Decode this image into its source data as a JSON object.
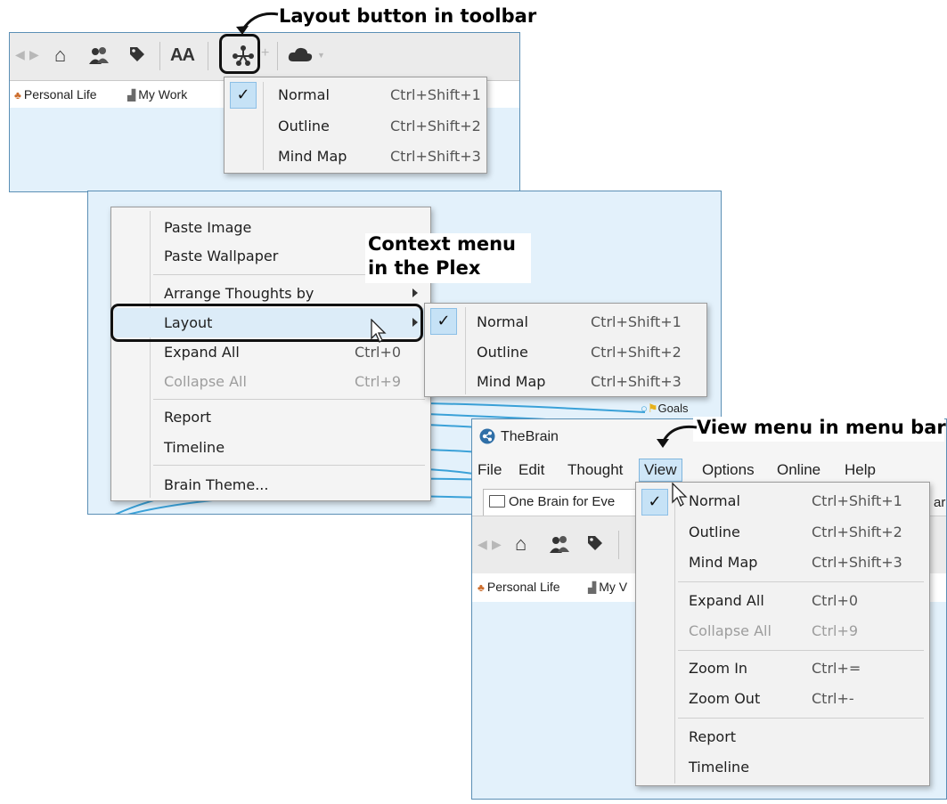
{
  "callouts": {
    "toolbar_layout": "Layout button in toolbar",
    "context_line1": "Context menu",
    "context_line2": "in the Plex",
    "view_menu": "View menu in menu bar"
  },
  "colors": {
    "plex_background": "#e3f1fb",
    "highlight": "#dcecf8",
    "check_background": "#c6e2f6",
    "link_lines": "#3aa1d8"
  },
  "toolbar_shot": {
    "icons": [
      "back-arrow-icon",
      "forward-arrow-icon",
      "home-icon",
      "people-icon",
      "tag-icon",
      "font-size-icon",
      "layout-icon",
      "cloud-icon"
    ],
    "font_size_label": "AA",
    "bookmarks": [
      "Personal Life",
      "My Work"
    ],
    "layout_menu": [
      {
        "label": "Normal",
        "shortcut": "Ctrl+Shift+1",
        "checked": true
      },
      {
        "label": "Outline",
        "shortcut": "Ctrl+Shift+2",
        "checked": false
      },
      {
        "label": "Mind Map",
        "shortcut": "Ctrl+Shift+3",
        "checked": false
      }
    ]
  },
  "context_shot": {
    "menu": [
      {
        "label": "Paste Image",
        "shortcut": "",
        "disabled": false
      },
      {
        "label": "Paste Wallpaper",
        "shortcut": "",
        "disabled": false
      },
      {
        "label": "Arrange Thoughts by",
        "shortcut": "",
        "disabled": false,
        "submenu": true
      },
      {
        "label": "Layout",
        "shortcut": "",
        "disabled": false,
        "submenu": true,
        "highlighted": true
      },
      {
        "label": "Expand All",
        "shortcut": "Ctrl+0",
        "disabled": false
      },
      {
        "label": "Collapse All",
        "shortcut": "Ctrl+9",
        "disabled": true
      },
      {
        "label": "Report",
        "shortcut": "",
        "disabled": false
      },
      {
        "label": "Timeline",
        "shortcut": "",
        "disabled": false
      },
      {
        "label": "Brain Theme...",
        "shortcut": "",
        "disabled": false
      }
    ],
    "layout_submenu": [
      {
        "label": "Normal",
        "shortcut": "Ctrl+Shift+1",
        "checked": true
      },
      {
        "label": "Outline",
        "shortcut": "Ctrl+Shift+2",
        "checked": false
      },
      {
        "label": "Mind Map",
        "shortcut": "Ctrl+Shift+3",
        "checked": false
      }
    ],
    "thought_label": "Goals"
  },
  "app_shot": {
    "app_title": "TheBrain",
    "menubar": [
      "File",
      "Edit",
      "Thought",
      "View",
      "Options",
      "Online",
      "Help"
    ],
    "tab_label": "One Brain for Eve",
    "tab_cut": "ar",
    "bookmarks": [
      "Personal Life",
      "My V"
    ],
    "view_menu": [
      {
        "label": "Normal",
        "shortcut": "Ctrl+Shift+1",
        "checked": true,
        "disabled": false
      },
      {
        "label": "Outline",
        "shortcut": "Ctrl+Shift+2",
        "checked": false,
        "disabled": false
      },
      {
        "label": "Mind Map",
        "shortcut": "Ctrl+Shift+3",
        "checked": false,
        "disabled": false
      },
      {
        "label": "Expand All",
        "shortcut": "Ctrl+0",
        "checked": false,
        "disabled": false
      },
      {
        "label": "Collapse All",
        "shortcut": "Ctrl+9",
        "checked": false,
        "disabled": true
      },
      {
        "label": "Zoom In",
        "shortcut": "Ctrl+=",
        "checked": false,
        "disabled": false
      },
      {
        "label": "Zoom Out",
        "shortcut": "Ctrl+-",
        "checked": false,
        "disabled": false
      },
      {
        "label": "Report",
        "shortcut": "",
        "checked": false,
        "disabled": false
      },
      {
        "label": "Timeline",
        "shortcut": "",
        "checked": false,
        "disabled": false
      }
    ]
  }
}
